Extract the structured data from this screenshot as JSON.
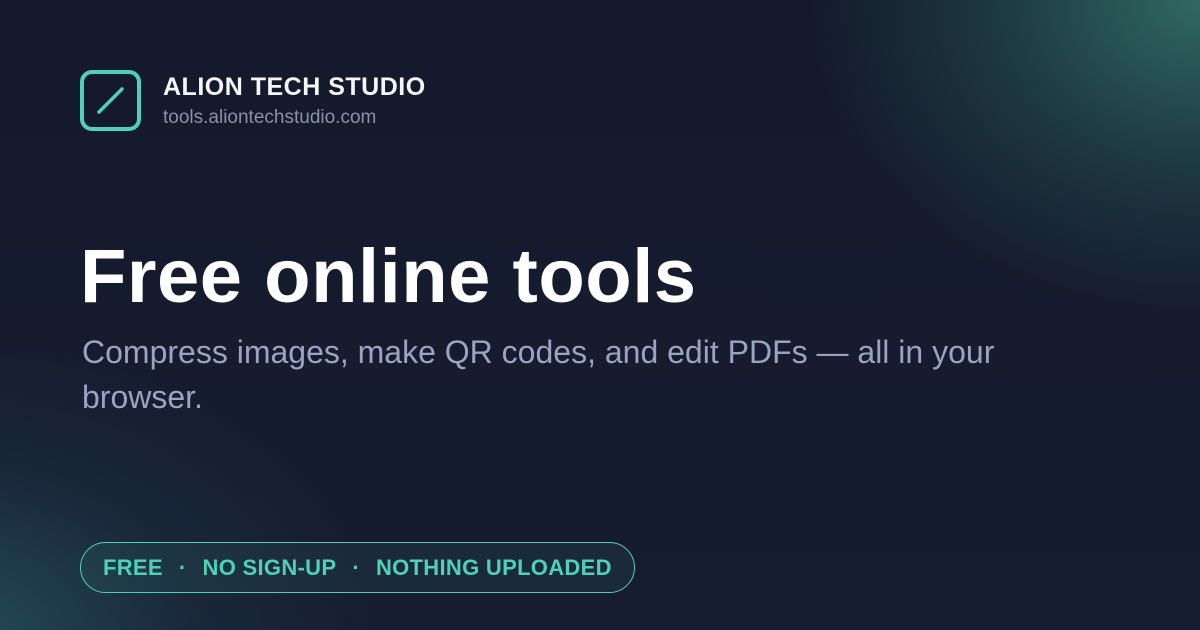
{
  "brand": {
    "name": "ALION TECH STUDIO",
    "url": "tools.aliontechstudio.com",
    "logo_icon": "slash-icon",
    "accent": "#4fd1b8"
  },
  "hero": {
    "title": "Free online tools",
    "subtitle": "Compress images, make QR codes, and edit PDFs — all in your browser."
  },
  "badge": {
    "items": [
      "FREE",
      "NO SIGN-UP",
      "NOTHING UPLOADED"
    ],
    "separator": "·"
  }
}
